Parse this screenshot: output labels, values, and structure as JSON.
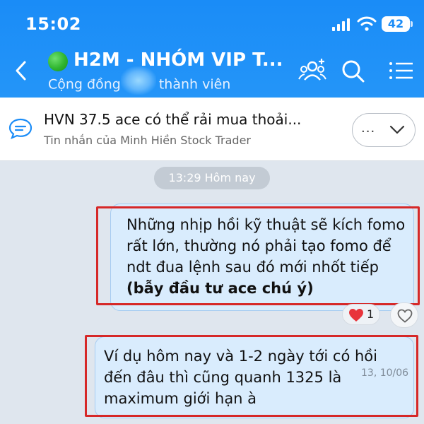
{
  "status_bar": {
    "time": "15:02",
    "battery": "42"
  },
  "header": {
    "title": "H2M - NHÓM VIP T...",
    "subtitle_left": "Cộng đồng",
    "subtitle_right": "thành viên"
  },
  "pinned": {
    "title": "HVN 37.5 ace có thể rải mua thoải...",
    "subtitle": "Tin nhắn của Minh Hiền Stock Trader",
    "more_label": "..."
  },
  "timestamp": "13:29 Hôm nay",
  "messages": [
    {
      "text_plain": "Những nhịp hồi kỹ thuật sẽ kích fomo rất lớn, thường nó phải tạo fomo để ndt đua lệnh sau đó mới nhốt tiếp",
      "text_bold": "(bẫy đầu tư ace chú ý)",
      "reaction_count": "1"
    },
    {
      "text": "Ví dụ hôm nay và 1-2 ngày tới có hồi đến đâu thì cũng quanh 1325 là maximum giới hạn à",
      "stamp": "13, 10/06"
    }
  ],
  "colors": {
    "header_blue": "#1a8cf7",
    "bubble": "#d9ecfd",
    "highlight_red": "#d62828"
  },
  "icons": [
    "back-icon",
    "online-dot-icon",
    "add-member-icon",
    "search-icon",
    "menu-icon",
    "message-bubble-icon",
    "chevron-down-icon",
    "heart-icon",
    "heart-outline-icon"
  ]
}
